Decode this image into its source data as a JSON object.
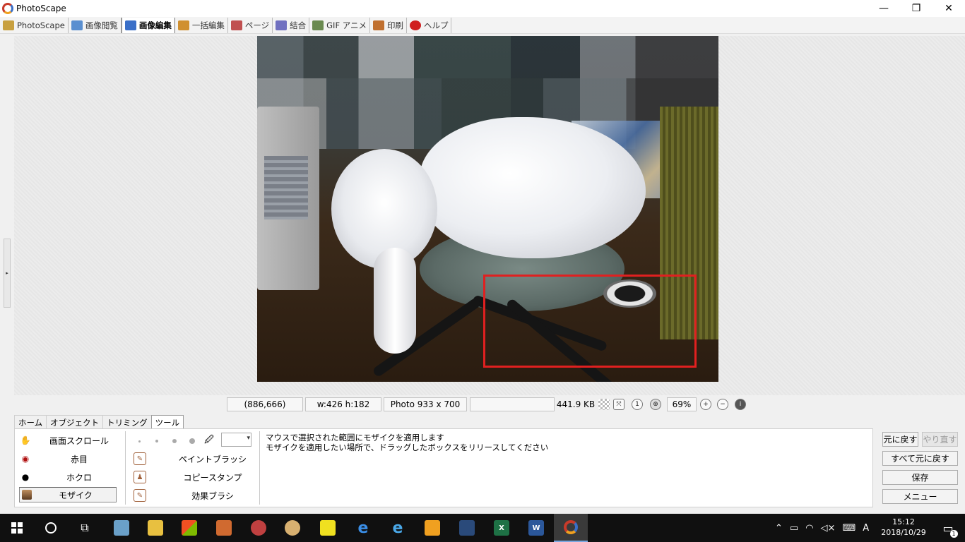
{
  "window": {
    "title": "PhotoScape",
    "minimize": "—",
    "maximize": "❐",
    "close": "✕"
  },
  "tabs": [
    {
      "label": "PhotoScape",
      "color": "#c8a040"
    },
    {
      "label": "画像閲覧",
      "color": "#5a8fd0"
    },
    {
      "label": "画像編集",
      "color": "#3a6fc8"
    },
    {
      "label": "一括編集",
      "color": "#d09030"
    },
    {
      "label": "ページ",
      "color": "#c05050"
    },
    {
      "label": "結合",
      "color": "#7070c0"
    },
    {
      "label": "GIF アニメ",
      "color": "#6a8a50"
    },
    {
      "label": "印刷",
      "color": "#c07030"
    },
    {
      "label": "ヘルプ",
      "color": "#d02020"
    }
  ],
  "active_tab": "画像編集",
  "statusbar": {
    "coords": "(886,666)",
    "selection_size": "w:426 h:182",
    "photo_size": "Photo 933 x 700",
    "empty_field": "",
    "file_size": "441.9 KB",
    "zoom": "69%"
  },
  "subtabs": [
    "ホーム",
    "オブジェクト",
    "トリミング",
    "ツール"
  ],
  "active_subtab": "ツール",
  "tools_left": [
    {
      "label": "画面スクロール",
      "icon": "hand-icon"
    },
    {
      "label": "赤目",
      "icon": "eye-icon"
    },
    {
      "label": "ホクロ",
      "icon": "mole-icon"
    },
    {
      "label": "モザイク",
      "icon": "mosaic-icon",
      "selected": true
    }
  ],
  "tools_right": [
    {
      "label": "ペイントブラッシ",
      "icon": "paint-brush-icon"
    },
    {
      "label": "コピースタンプ",
      "icon": "clone-stamp-icon"
    },
    {
      "label": "効果ブラシ",
      "icon": "effect-brush-icon"
    }
  ],
  "help": {
    "line1": "マウスで選択された範囲にモザイクを適用します",
    "line2": "モザイクを適用したい場所で、ドラッグしたボックスをリリースしてください"
  },
  "buttons": {
    "undo": "元に戻す",
    "redo": "やり直す",
    "undo_all": "すべて元に戻す",
    "save": "保存",
    "menu": "メニュー"
  },
  "taskbar": {
    "clock_time": "15:12",
    "clock_date": "2018/10/29",
    "ime": "A",
    "notification_count": "1"
  }
}
